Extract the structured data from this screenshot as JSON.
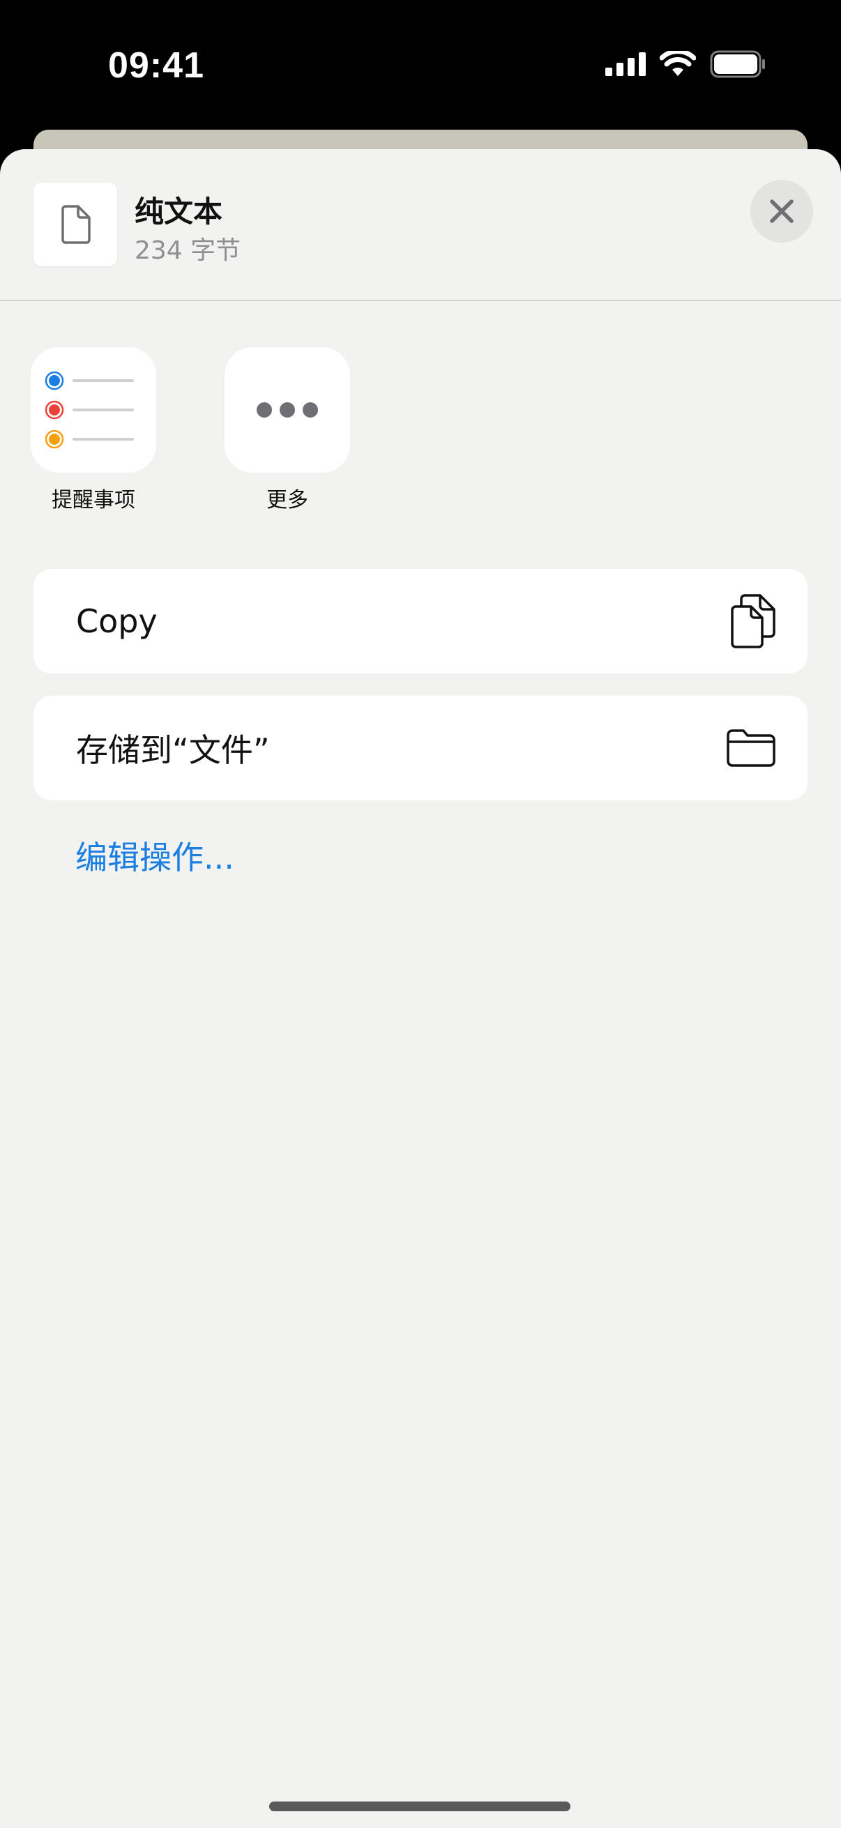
{
  "status_bar": {
    "time": "09:41"
  },
  "sheet": {
    "file": {
      "title": "纯文本",
      "subtitle": "234 字节",
      "icon": "document-icon"
    },
    "close_icon": "close-icon"
  },
  "apps": [
    {
      "label": "提醒事项",
      "icon": "reminders-icon",
      "dot_colors": [
        "#1a7fe0",
        "#e8423a",
        "#f5a00f"
      ]
    },
    {
      "label": "更多",
      "icon": "more-icon"
    }
  ],
  "actions": [
    {
      "label": "Copy",
      "icon": "copy-icon"
    },
    {
      "label": "存储到“文件”",
      "icon": "folder-icon"
    }
  ],
  "edit_actions_label": "编辑操作...",
  "colors": {
    "accent": "#1a7fe0",
    "sheet_background": "#f2f2f0"
  }
}
